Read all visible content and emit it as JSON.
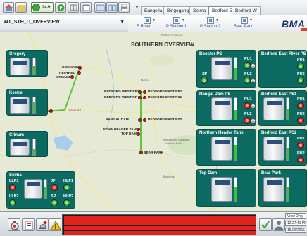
{
  "toolbar": {
    "back_label": "Back",
    "tabs": [
      {
        "label": "Eungella",
        "active": false
      },
      {
        "label": "Bingegang",
        "active": false
      },
      {
        "label": "Selma",
        "active": false
      },
      {
        "label": "Bedford E",
        "active": true
      },
      {
        "label": "Bedford W",
        "active": false
      }
    ]
  },
  "title": "WT_STH_O_OVERVIEW",
  "nav": {
    "items": [
      "B River",
      "P Station 1",
      "P Station 2",
      "Bear Park"
    ]
  },
  "brand": "BMA",
  "map": {
    "title": "SOUTHERN OVERVIEW",
    "sites": [
      "GREGORY",
      "KESTREL",
      "CRINUM",
      "SELMA",
      "BEDFORD WEST RPS",
      "BEDFORD EAST RPS",
      "BEDFORD WEST RP 5",
      "BEDFORD EAST PS1",
      "RANGAL DAM",
      "BEDFORD EAST PS2",
      "NTH/N HEADER TANK",
      "TOP DAM",
      "BEAR PARK"
    ]
  },
  "panels": {
    "gregory": {
      "title": "Gregory"
    },
    "kestrel": {
      "title": "Kestrel"
    },
    "crinum": {
      "title": "Crinum"
    },
    "selma": {
      "title": "Selma",
      "pumps": [
        "LLP1",
        "LLP2",
        "JP",
        "SP",
        "HLP1",
        "HLP2"
      ]
    },
    "booster_ps": {
      "title": "Booster PS",
      "pumps": [
        "PU1",
        "PU2",
        "SP"
      ]
    },
    "bedford_east_river_ps": {
      "title": "Bedford East River PS",
      "pumps": [
        "PU1",
        "PU2"
      ]
    },
    "rangal_dam_ps": {
      "title": "Rangal Dam PS",
      "pumps": [
        "PU1",
        "PU2"
      ]
    },
    "bedford_east_ps1": {
      "title": "Bedford East PS1",
      "pumps": [
        "PU1",
        "PU2"
      ]
    },
    "northern_header_tank": {
      "title": "Northern Header Tank"
    },
    "bedford_east_ps2": {
      "title": "Bedford East PS2",
      "pumps": [
        "PU1",
        "PU2"
      ]
    },
    "top_dam": {
      "title": "Top Dam"
    },
    "bear_park": {
      "title": "Bear Park"
    }
  },
  "status": {
    "view_mode": "View Only",
    "time": "12:27:41 PM",
    "date": "15/09/2015"
  },
  "colors": {
    "panel": "#0b6b63",
    "alarm": "#e0231b",
    "pump_on": "#2fb33b",
    "pump_off": "#d8241f",
    "brand": "#1b2f6b"
  }
}
